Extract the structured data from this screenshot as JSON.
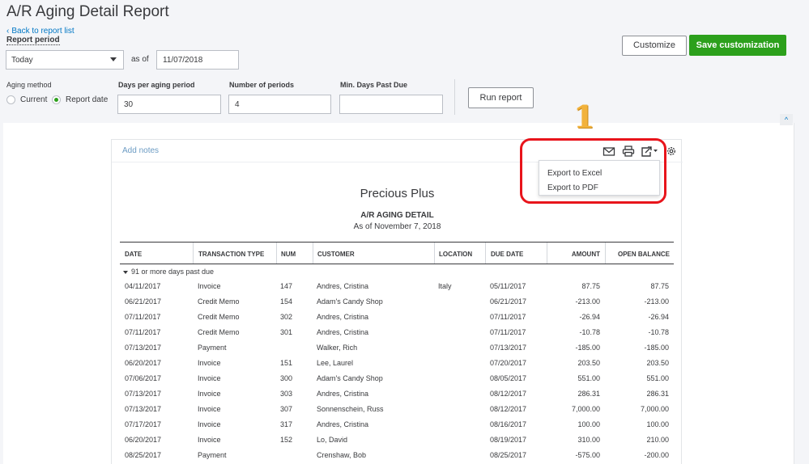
{
  "page": {
    "title": "A/R Aging Detail Report",
    "back_link": "Back to report list",
    "report_period_label": "Report period"
  },
  "filters": {
    "period_value": "Today",
    "as_of_label": "as of",
    "as_of_date": "11/07/2018",
    "aging_method_label": "Aging method",
    "aging_current": "Current",
    "aging_report_date": "Report date",
    "days_per_period_label": "Days per aging period",
    "days_per_period_value": "30",
    "num_periods_label": "Number of periods",
    "num_periods_value": "4",
    "min_days_label": "Min. Days Past Due",
    "min_days_value": "",
    "run_report": "Run report"
  },
  "actions": {
    "customize": "Customize",
    "save_customization": "Save customization"
  },
  "toolbar": {
    "add_notes": "Add notes",
    "icons": [
      "email-icon",
      "print-icon",
      "export-icon",
      "gear-icon"
    ]
  },
  "export_menu": {
    "excel": "Export to Excel",
    "pdf": "Export to PDF"
  },
  "annotation": {
    "step": "1",
    "highlight_color": "#e8141b"
  },
  "report": {
    "company": "Precious Plus",
    "title": "A/R AGING DETAIL",
    "subtitle": "As of November 7, 2018",
    "columns": [
      "DATE",
      "TRANSACTION TYPE",
      "NUM",
      "CUSTOMER",
      "LOCATION",
      "DUE DATE",
      "AMOUNT",
      "OPEN BALANCE"
    ],
    "group_label": "91 or more days past due",
    "rows": [
      [
        "04/11/2017",
        "Invoice",
        "147",
        "Andres, Cristina",
        "Italy",
        "05/11/2017",
        "87.75",
        "87.75"
      ],
      [
        "06/21/2017",
        "Credit Memo",
        "154",
        "Adam's Candy Shop",
        "",
        "06/21/2017",
        "-213.00",
        "-213.00"
      ],
      [
        "07/11/2017",
        "Credit Memo",
        "302",
        "Andres, Cristina",
        "",
        "07/11/2017",
        "-26.94",
        "-26.94"
      ],
      [
        "07/11/2017",
        "Credit Memo",
        "301",
        "Andres, Cristina",
        "",
        "07/11/2017",
        "-10.78",
        "-10.78"
      ],
      [
        "07/13/2017",
        "Payment",
        "",
        "Walker, Rich",
        "",
        "07/13/2017",
        "-185.00",
        "-185.00"
      ],
      [
        "06/20/2017",
        "Invoice",
        "151",
        "Lee, Laurel",
        "",
        "07/20/2017",
        "203.50",
        "203.50"
      ],
      [
        "07/06/2017",
        "Invoice",
        "300",
        "Adam's Candy Shop",
        "",
        "08/05/2017",
        "551.00",
        "551.00"
      ],
      [
        "07/13/2017",
        "Invoice",
        "303",
        "Andres, Cristina",
        "",
        "08/12/2017",
        "286.31",
        "286.31"
      ],
      [
        "07/13/2017",
        "Invoice",
        "307",
        "Sonnenschein, Russ",
        "",
        "08/12/2017",
        "7,000.00",
        "7,000.00"
      ],
      [
        "07/17/2017",
        "Invoice",
        "317",
        "Andres, Cristina",
        "",
        "08/16/2017",
        "100.00",
        "100.00"
      ],
      [
        "06/20/2017",
        "Invoice",
        "152",
        "Lo, David",
        "",
        "08/19/2017",
        "310.00",
        "210.00"
      ],
      [
        "08/25/2017",
        "Payment",
        "",
        "Crenshaw, Bob",
        "",
        "08/25/2017",
        "-575.00",
        "-200.00"
      ]
    ]
  }
}
